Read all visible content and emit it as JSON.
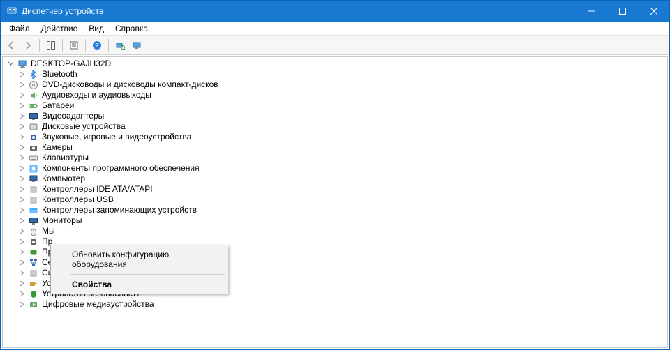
{
  "titlebar": {
    "title": "Диспетчер устройств"
  },
  "menu": {
    "file": "Файл",
    "action": "Действие",
    "view": "Вид",
    "help": "Справка"
  },
  "tree": {
    "root": "DESKTOP-GAJH32D",
    "items": [
      {
        "label": "Bluetooth",
        "icon": "bluetooth"
      },
      {
        "label": "DVD-дисководы и дисководы компакт-дисков",
        "icon": "dvd"
      },
      {
        "label": "Аудиовходы и аудиовыходы",
        "icon": "audio"
      },
      {
        "label": "Батареи",
        "icon": "battery"
      },
      {
        "label": "Видеоадаптеры",
        "icon": "display"
      },
      {
        "label": "Дисковые устройства",
        "icon": "disk"
      },
      {
        "label": "Звуковые, игровые и видеоустройства",
        "icon": "sound"
      },
      {
        "label": "Камеры",
        "icon": "camera"
      },
      {
        "label": "Клавиатуры",
        "icon": "keyboard"
      },
      {
        "label": "Компоненты программного обеспечения",
        "icon": "software"
      },
      {
        "label": "Компьютер",
        "icon": "computer"
      },
      {
        "label": "Контроллеры IDE ATA/ATAPI",
        "icon": "ide"
      },
      {
        "label": "Контроллеры USB",
        "icon": "usb"
      },
      {
        "label": "Контроллеры запоминающих устройств",
        "icon": "storage"
      },
      {
        "label": "Мониторы",
        "icon": "monitor"
      },
      {
        "label": "Мы",
        "icon": "mouse"
      },
      {
        "label": "Пр",
        "icon": "firmware"
      },
      {
        "label": "Пр",
        "icon": "processor"
      },
      {
        "label": "Сетевые адаптеры",
        "icon": "network"
      },
      {
        "label": "Системные устройства",
        "icon": "system"
      },
      {
        "label": "Устройства HID (Human Interface Devices)",
        "icon": "hid"
      },
      {
        "label": "Устройства безопасности",
        "icon": "security"
      },
      {
        "label": "Цифровые медиаустройства",
        "icon": "media"
      }
    ]
  },
  "context": {
    "scan": "Обновить конфигурацию оборудования",
    "properties": "Свойства"
  },
  "icons": {
    "bluetooth": "#2a7ce0",
    "dvd": "#888",
    "audio": "#6a6",
    "battery": "#6a6",
    "display": "#36a",
    "disk": "#888",
    "sound": "#36a",
    "camera": "#666",
    "keyboard": "#888",
    "software": "#4af",
    "computer": "#36a",
    "ide": "#999",
    "usb": "#999",
    "storage": "#4af",
    "monitor": "#36a",
    "mouse": "#888",
    "firmware": "#666",
    "processor": "#493",
    "network": "#36a",
    "system": "#999",
    "hid": "#c93",
    "security": "#393",
    "media": "#6a6",
    "pc": "#36a"
  }
}
